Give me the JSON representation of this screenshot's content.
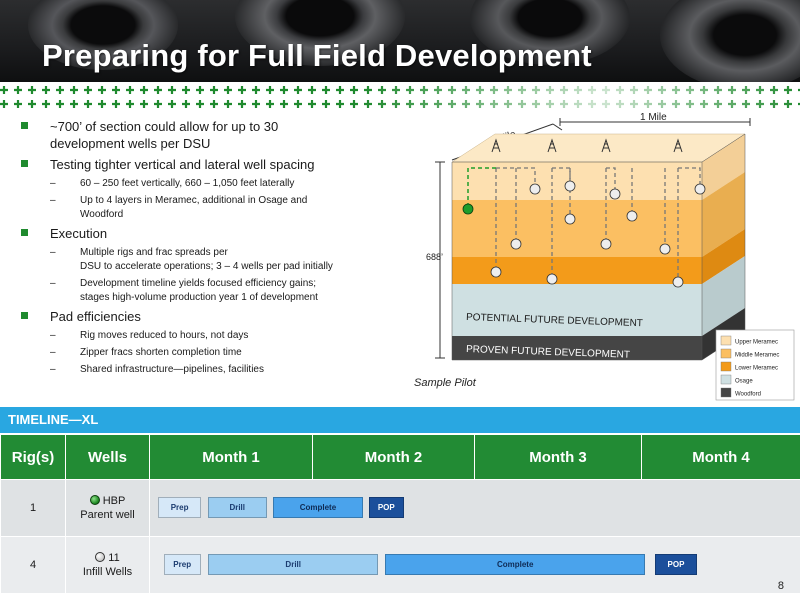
{
  "title": "Preparing for Full Field Development",
  "bullets": [
    {
      "text_lines": [
        "~700’ of section could allow for up to 30",
        "development wells per DSU"
      ],
      "sub": []
    },
    {
      "text_lines": [
        "Testing tighter vertical and lateral well spacing"
      ],
      "sub": [
        {
          "lines": [
            "60 – 250 feet vertically, 660 – 1,050 feet laterally"
          ]
        },
        {
          "lines": [
            "Up to 4 layers in Meramec, additional in Osage and",
            "Woodford"
          ]
        }
      ]
    },
    {
      "text_lines": [
        "Execution"
      ],
      "sub": [
        {
          "lines": [
            "Multiple rigs and frac spreads per",
            "DSU to accelerate operations; 3 – 4 wells per pad initially"
          ]
        },
        {
          "lines": [
            "Development timeline yields focused efficiency gains;",
            "stages high-volume production year 1 of development"
          ]
        }
      ]
    },
    {
      "text_lines": [
        "Pad efficiencies"
      ],
      "sub": [
        {
          "lines": [
            "Rig moves reduced to hours, not days"
          ]
        },
        {
          "lines": [
            "Zipper fracs shorten completion time"
          ]
        },
        {
          "lines": [
            "Shared  infrastructure—pipelines, facilities"
          ]
        }
      ]
    }
  ],
  "diagram": {
    "dim_left": "1 Mile",
    "dim_right": "1 Mile",
    "dim_height": "688’",
    "layer_potential": "POTENTIAL FUTURE DEVELOPMENT",
    "layer_proven": "PROVEN FUTURE DEVELOPMENT",
    "caption": "Sample Pilot",
    "legend": [
      {
        "label": "Upper Meramec",
        "color": "#fde0b0"
      },
      {
        "label": "Middle Meramec",
        "color": "#fbbf62"
      },
      {
        "label": "Lower Meramec",
        "color": "#f39b1a"
      },
      {
        "label": "Osage",
        "color": "#cfe0e2"
      },
      {
        "label": "Woodford",
        "color": "#454545"
      }
    ],
    "colors": {
      "upper": "#fde0b0",
      "middle": "#fbbf62",
      "lower": "#f39b1a",
      "osage": "#cfe0e2",
      "woodford": "#454545"
    }
  },
  "timeline": {
    "header": "TIMELINE—XL",
    "columns": [
      "Rig(s)",
      "Wells",
      "Month 1",
      "Month 2",
      "Month 3",
      "Month 4"
    ],
    "rows": [
      {
        "rigs": "1",
        "wells_count": "HBP",
        "wells_label": "Parent well",
        "icon": "green",
        "bars": [
          {
            "label": "Prep",
            "start": 0.013,
            "end": 0.078,
            "color": "#d6e8f8",
            "text": "#1b3b6f"
          },
          {
            "label": "Drill",
            "start": 0.089,
            "end": 0.179,
            "color": "#9bcdf1",
            "text": "#1b3b6f"
          },
          {
            "label": "Complete",
            "start": 0.189,
            "end": 0.327,
            "color": "#4aa3ec",
            "text": "#0f2b55"
          },
          {
            "label": "POP",
            "start": 0.336,
            "end": 0.39,
            "color": "#1b4f9b",
            "text": "#ffffff"
          }
        ]
      },
      {
        "rigs": "4",
        "wells_count": "11",
        "wells_label": "Infill Wells",
        "icon": "white",
        "bars": [
          {
            "label": "Prep",
            "start": 0.021,
            "end": 0.078,
            "color": "#d6e8f8",
            "text": "#1b3b6f"
          },
          {
            "label": "Drill",
            "start": 0.089,
            "end": 0.351,
            "color": "#9bcdf1",
            "text": "#1b3b6f"
          },
          {
            "label": "Complete",
            "start": 0.361,
            "end": 0.761,
            "color": "#4aa3ec",
            "text": "#0f2b55"
          },
          {
            "label": "POP",
            "start": 0.775,
            "end": 0.841,
            "color": "#1b4f9b",
            "text": "#ffffff"
          }
        ]
      }
    ]
  },
  "page_number": "8"
}
